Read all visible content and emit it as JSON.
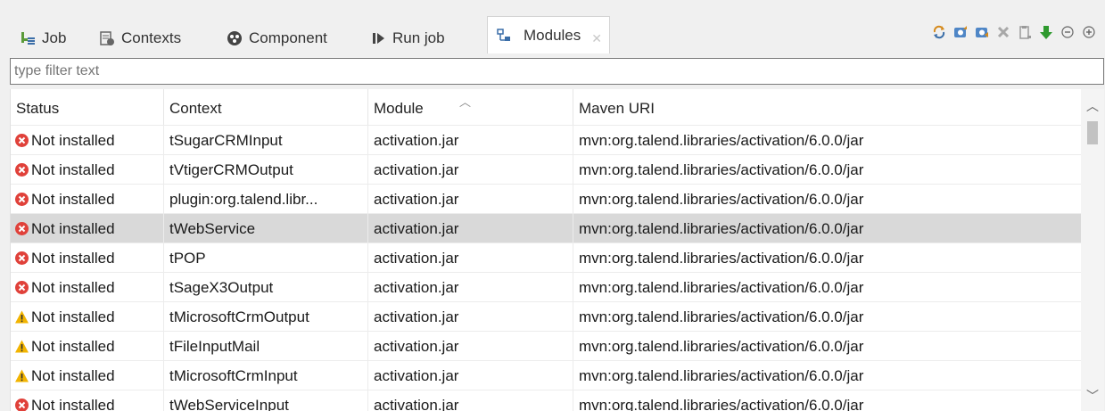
{
  "tabs": [
    {
      "label": "Job",
      "icon": "job-icon"
    },
    {
      "label": "Contexts",
      "icon": "contexts-icon"
    },
    {
      "label": "Component",
      "icon": "component-icon"
    },
    {
      "label": "Run job",
      "icon": "run-job-icon"
    },
    {
      "label": "Modules",
      "icon": "modules-icon",
      "active": true
    }
  ],
  "toolbar": [
    "refresh-icon",
    "import-icon",
    "export-icon",
    "delete-icon",
    "clipboard-icon",
    "download-icon",
    "collapse-icon",
    "expand-icon"
  ],
  "filter": {
    "placeholder": "type filter text",
    "value": ""
  },
  "table": {
    "columns": [
      "Status",
      "Context",
      "Module",
      "Maven URI"
    ],
    "rows": [
      {
        "status_icon": "error-icon",
        "status": "Not installed",
        "context": "tSugarCRMInput",
        "module": "activation.jar",
        "uri": "mvn:org.talend.libraries/activation/6.0.0/jar"
      },
      {
        "status_icon": "error-icon",
        "status": "Not installed",
        "context": "tVtigerCRMOutput",
        "module": "activation.jar",
        "uri": "mvn:org.talend.libraries/activation/6.0.0/jar"
      },
      {
        "status_icon": "error-icon",
        "status": "Not installed",
        "context": "plugin:org.talend.libr...",
        "module": "activation.jar",
        "uri": "mvn:org.talend.libraries/activation/6.0.0/jar"
      },
      {
        "status_icon": "error-icon",
        "status": "Not installed",
        "context": "tWebService",
        "module": "activation.jar",
        "uri": "mvn:org.talend.libraries/activation/6.0.0/jar",
        "selected": true
      },
      {
        "status_icon": "error-icon",
        "status": "Not installed",
        "context": "tPOP",
        "module": "activation.jar",
        "uri": "mvn:org.talend.libraries/activation/6.0.0/jar"
      },
      {
        "status_icon": "error-icon",
        "status": "Not installed",
        "context": "tSageX3Output",
        "module": "activation.jar",
        "uri": "mvn:org.talend.libraries/activation/6.0.0/jar"
      },
      {
        "status_icon": "warning-icon",
        "status": "Not installed",
        "context": "tMicrosoftCrmOutput",
        "module": "activation.jar",
        "uri": "mvn:org.talend.libraries/activation/6.0.0/jar"
      },
      {
        "status_icon": "warning-icon",
        "status": "Not installed",
        "context": "tFileInputMail",
        "module": "activation.jar",
        "uri": "mvn:org.talend.libraries/activation/6.0.0/jar"
      },
      {
        "status_icon": "warning-icon",
        "status": "Not installed",
        "context": "tMicrosoftCrmInput",
        "module": "activation.jar",
        "uri": "mvn:org.talend.libraries/activation/6.0.0/jar"
      },
      {
        "status_icon": "error-icon",
        "status": "Not installed",
        "context": "tWebServiceInput",
        "module": "activation.jar",
        "uri": "mvn:org.talend.libraries/activation/6.0.0/jar"
      }
    ]
  },
  "colors": {
    "error": "#e0413a",
    "warning": "#f2b400",
    "selected_row": "#d9d9d9",
    "download_arrow": "#2e9a2e"
  }
}
